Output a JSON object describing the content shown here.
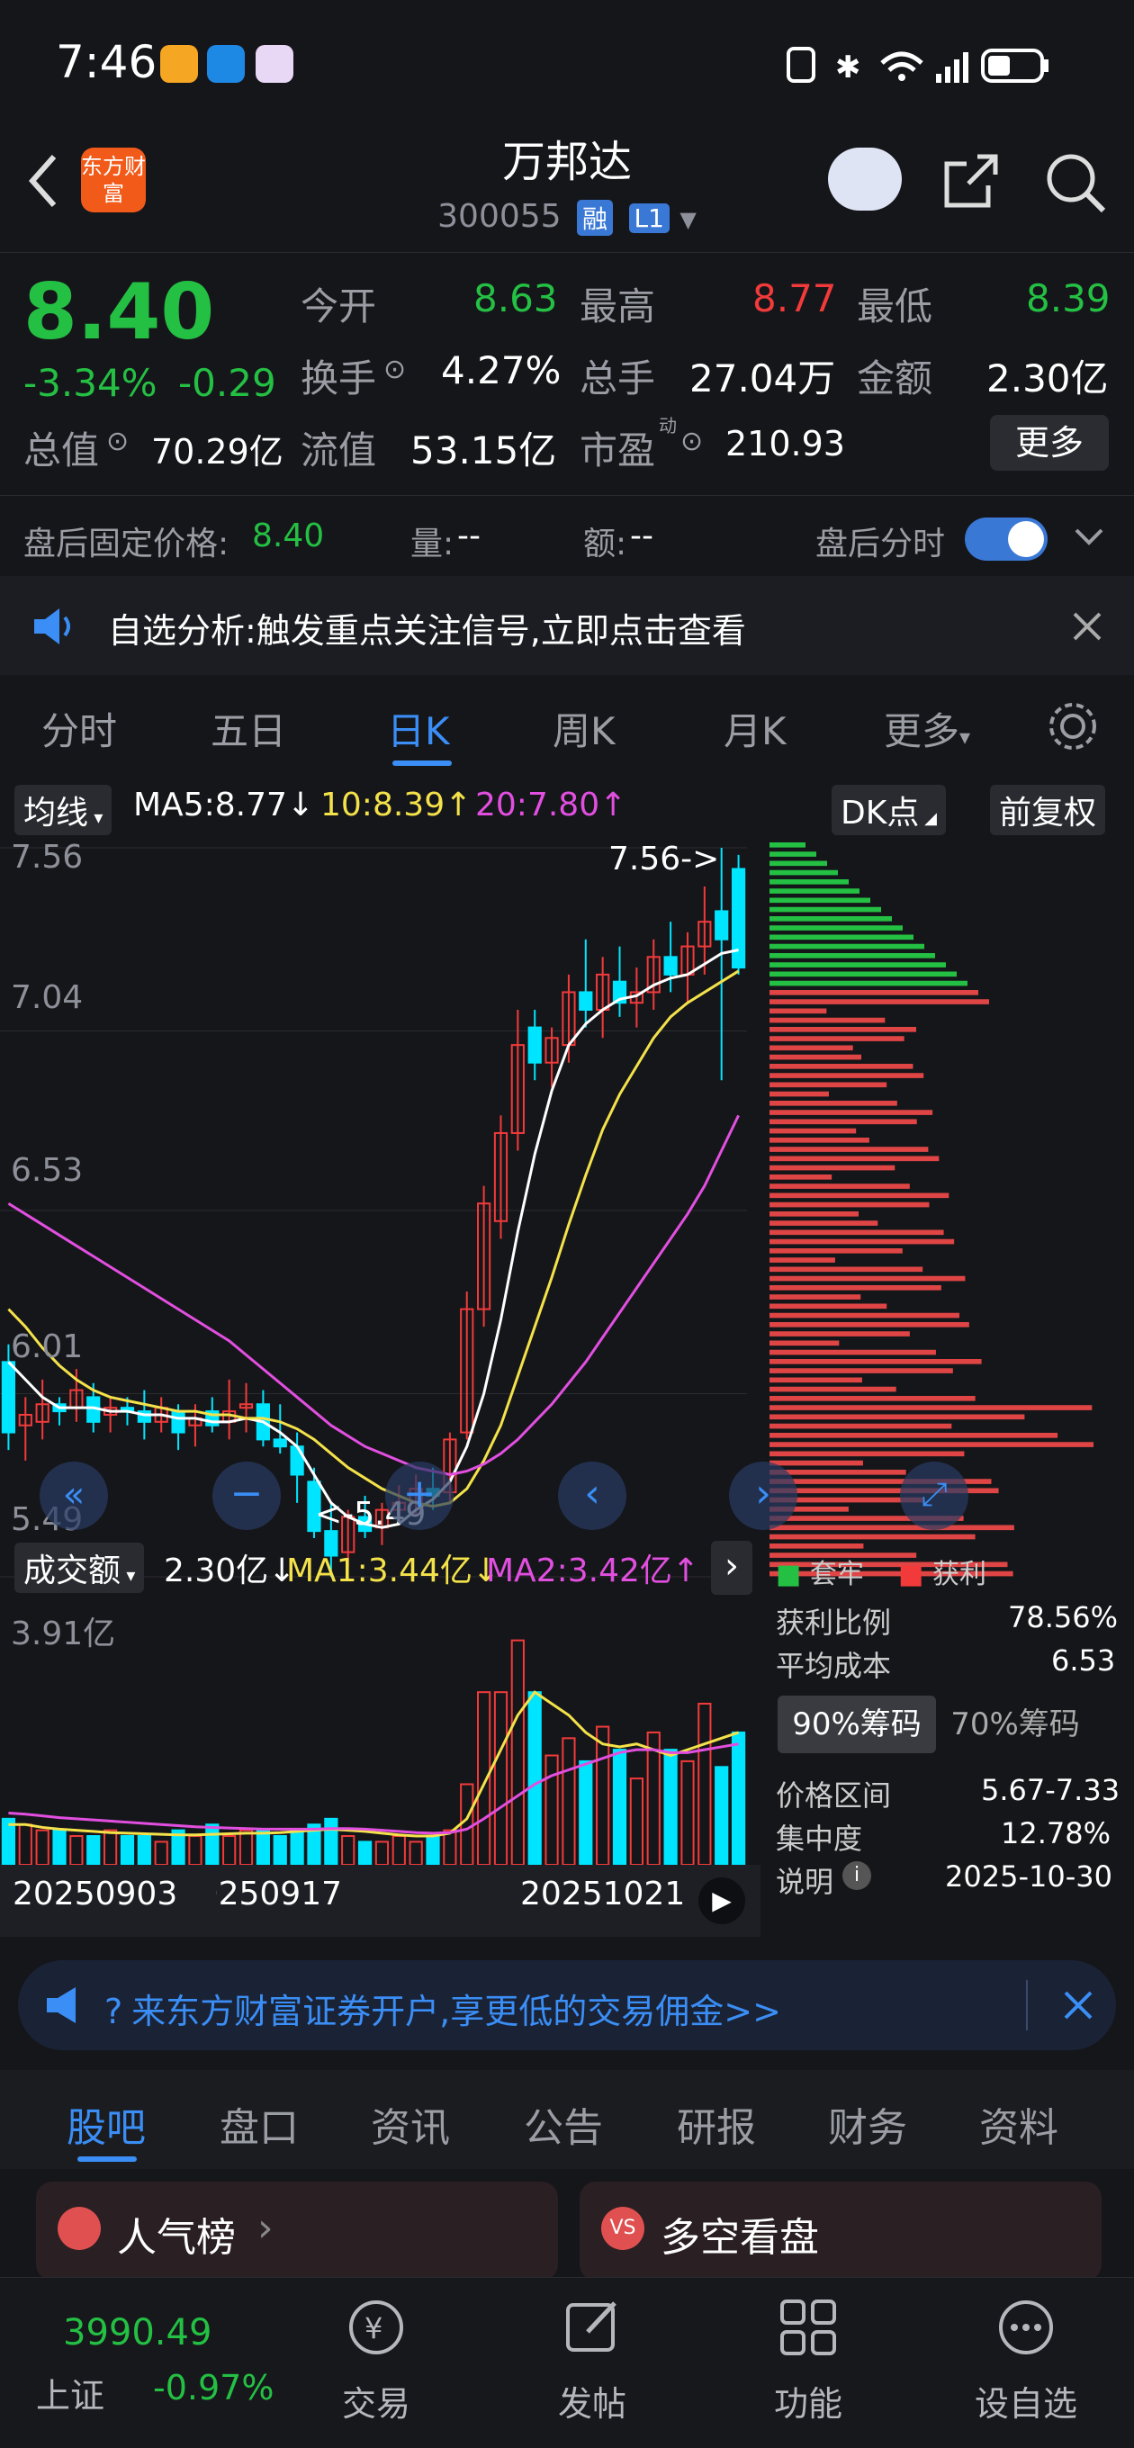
{
  "status": {
    "time": "7:46"
  },
  "header": {
    "logo": "东方财富",
    "name": "万邦达",
    "code": "300055",
    "tag1": "融",
    "tag2": "L1"
  },
  "quote": {
    "price": "8.40",
    "change_pct": "-3.34%",
    "change": "-0.29",
    "open_label": "今开",
    "open": "8.63",
    "high_label": "最高",
    "high": "8.77",
    "low_label": "最低",
    "low": "8.39",
    "turnover_label": "换手",
    "turnover": "4.27%",
    "volume_label": "总手",
    "volume": "27.04万",
    "amount_label": "金额",
    "amount": "2.30亿",
    "mktcap_label": "总值",
    "mktcap": "70.29亿",
    "float_label": "流值",
    "float": "53.15亿",
    "pe_label": "市盈",
    "pe_sup": "动",
    "pe": "210.93",
    "more": "更多"
  },
  "after_hours": {
    "label": "盘后固定价格:",
    "price": "8.40",
    "vol_label": "量:",
    "vol": "--",
    "amt_label": "额:",
    "amt": "--",
    "switch_label": "盘后分时",
    "switch_on": true
  },
  "notice": {
    "text": "自选分析:触发重点关注信号,立即点击查看"
  },
  "tabs": [
    "分时",
    "五日",
    "日K",
    "周K",
    "月K",
    "更多"
  ],
  "chart": {
    "ma_selector": "均线",
    "ma5": "MA5:8.77↓",
    "ma10": "10:8.39↑",
    "ma20": "20:7.80↑",
    "dk_button": "DK点",
    "adjust_button": "前复权",
    "y_labels": [
      "7.56",
      "7.04",
      "6.53",
      "6.01",
      "5.49"
    ],
    "high_marker": "7.56->",
    "low_marker": "<-5.49",
    "vol_selector": "成交额",
    "vol_value": "2.30亿↓",
    "vol_ma1": "MA1:3.44亿↓",
    "vol_ma2": "MA2:3.42亿↑",
    "vol_max": "3.91亿",
    "x_labels": [
      "20250903",
      "20250917",
      "20251021"
    ],
    "colors": {
      "up": "#f23a3a",
      "down": "#00e5ff",
      "ma5": "#ffffff",
      "ma10": "#f4e24a",
      "ma20": "#e24fe0"
    }
  },
  "chips": {
    "legend_trapped": "套牢",
    "legend_profit": "获利",
    "profit_ratio_label": "获利比例",
    "profit_ratio": "78.56%",
    "avg_cost_label": "平均成本",
    "avg_cost": "6.53",
    "tab90": "90%筹码",
    "tab70": "70%筹码",
    "range_label": "价格区间",
    "range": "5.67-7.33",
    "concentration_label": "集中度",
    "concentration": "12.78%",
    "note_label": "说明",
    "date": "2025-10-30"
  },
  "promo": {
    "text": "来东方财富证券开户,享更低的交易佣金>>"
  },
  "section_tabs": [
    "股吧",
    "盘口",
    "资讯",
    "公告",
    "研报",
    "财务",
    "资料"
  ],
  "cards": {
    "left": "人气榜",
    "right": "多空看盘"
  },
  "bottom_nav": {
    "index_value": "3990.49",
    "index_name": "上证",
    "index_change": "-0.97%",
    "items": [
      "交易",
      "发帖",
      "功能",
      "设自选"
    ]
  },
  "chart_data": {
    "type": "candlestick",
    "ylim": [
      5.49,
      7.56
    ],
    "candles": [
      {
        "o": 6.1,
        "h": 6.15,
        "l": 5.85,
        "c": 5.9
      },
      {
        "o": 5.92,
        "h": 6.0,
        "l": 5.82,
        "c": 5.95
      },
      {
        "o": 5.93,
        "h": 6.05,
        "l": 5.88,
        "c": 5.98
      },
      {
        "o": 5.98,
        "h": 6.0,
        "l": 5.92,
        "c": 5.96
      },
      {
        "o": 5.97,
        "h": 6.08,
        "l": 5.93,
        "c": 6.02
      },
      {
        "o": 6.0,
        "h": 6.04,
        "l": 5.9,
        "c": 5.93
      },
      {
        "o": 5.95,
        "h": 6.0,
        "l": 5.9,
        "c": 5.97
      },
      {
        "o": 5.97,
        "h": 6.0,
        "l": 5.92,
        "c": 5.96
      },
      {
        "o": 5.96,
        "h": 6.02,
        "l": 5.88,
        "c": 5.93
      },
      {
        "o": 5.93,
        "h": 6.0,
        "l": 5.9,
        "c": 5.97
      },
      {
        "o": 5.96,
        "h": 5.98,
        "l": 5.85,
        "c": 5.9
      },
      {
        "o": 5.92,
        "h": 5.98,
        "l": 5.86,
        "c": 5.94
      },
      {
        "o": 5.96,
        "h": 6.0,
        "l": 5.9,
        "c": 5.92
      },
      {
        "o": 5.93,
        "h": 6.05,
        "l": 5.88,
        "c": 5.96
      },
      {
        "o": 5.97,
        "h": 6.04,
        "l": 5.9,
        "c": 5.98
      },
      {
        "o": 5.98,
        "h": 6.02,
        "l": 5.86,
        "c": 5.88
      },
      {
        "o": 5.88,
        "h": 5.98,
        "l": 5.84,
        "c": 5.86
      },
      {
        "o": 5.86,
        "h": 5.9,
        "l": 5.7,
        "c": 5.78
      },
      {
        "o": 5.76,
        "h": 5.8,
        "l": 5.6,
        "c": 5.62
      },
      {
        "o": 5.62,
        "h": 5.7,
        "l": 5.49,
        "c": 5.55
      },
      {
        "o": 5.56,
        "h": 5.68,
        "l": 5.52,
        "c": 5.66
      },
      {
        "o": 5.66,
        "h": 5.72,
        "l": 5.6,
        "c": 5.62
      },
      {
        "o": 5.63,
        "h": 5.7,
        "l": 5.58,
        "c": 5.68
      },
      {
        "o": 5.68,
        "h": 5.75,
        "l": 5.64,
        "c": 5.7
      },
      {
        "o": 5.7,
        "h": 5.78,
        "l": 5.66,
        "c": 5.74
      },
      {
        "o": 5.74,
        "h": 5.8,
        "l": 5.68,
        "c": 5.72
      },
      {
        "o": 5.73,
        "h": 5.9,
        "l": 5.7,
        "c": 5.88
      },
      {
        "o": 5.9,
        "h": 6.3,
        "l": 5.88,
        "c": 6.25
      },
      {
        "o": 6.25,
        "h": 6.6,
        "l": 6.2,
        "c": 6.55
      },
      {
        "o": 6.5,
        "h": 6.8,
        "l": 6.45,
        "c": 6.75
      },
      {
        "o": 6.75,
        "h": 7.1,
        "l": 6.7,
        "c": 7.0
      },
      {
        "o": 7.05,
        "h": 7.1,
        "l": 6.9,
        "c": 6.95
      },
      {
        "o": 6.95,
        "h": 7.05,
        "l": 6.88,
        "c": 7.02
      },
      {
        "o": 7.0,
        "h": 7.2,
        "l": 6.95,
        "c": 7.15
      },
      {
        "o": 7.15,
        "h": 7.3,
        "l": 7.05,
        "c": 7.1
      },
      {
        "o": 7.1,
        "h": 7.25,
        "l": 7.02,
        "c": 7.2
      },
      {
        "o": 7.18,
        "h": 7.28,
        "l": 7.08,
        "c": 7.12
      },
      {
        "o": 7.12,
        "h": 7.22,
        "l": 7.05,
        "c": 7.15
      },
      {
        "o": 7.15,
        "h": 7.3,
        "l": 7.1,
        "c": 7.25
      },
      {
        "o": 7.25,
        "h": 7.35,
        "l": 7.15,
        "c": 7.2
      },
      {
        "o": 7.2,
        "h": 7.32,
        "l": 7.12,
        "c": 7.28
      },
      {
        "o": 7.28,
        "h": 7.45,
        "l": 7.2,
        "c": 7.35
      },
      {
        "o": 7.38,
        "h": 7.56,
        "l": 6.9,
        "c": 7.3
      },
      {
        "o": 7.5,
        "h": 7.54,
        "l": 7.2,
        "c": 7.22
      }
    ],
    "ma5": [
      6.1,
      6.05,
      6.0,
      5.97,
      5.97,
      5.97,
      5.96,
      5.96,
      5.95,
      5.95,
      5.94,
      5.94,
      5.93,
      5.93,
      5.94,
      5.93,
      5.9,
      5.86,
      5.78,
      5.7,
      5.66,
      5.64,
      5.63,
      5.64,
      5.68,
      5.71,
      5.76,
      5.86,
      6.01,
      6.22,
      6.47,
      6.69,
      6.87,
      7.0,
      7.06,
      7.1,
      7.13,
      7.14,
      7.17,
      7.19,
      7.2,
      7.23,
      7.26,
      7.27
    ],
    "ma10": [
      6.25,
      6.2,
      6.14,
      6.09,
      6.05,
      6.02,
      6.0,
      5.99,
      5.98,
      5.97,
      5.96,
      5.96,
      5.95,
      5.95,
      5.94,
      5.94,
      5.93,
      5.91,
      5.88,
      5.84,
      5.8,
      5.77,
      5.74,
      5.72,
      5.7,
      5.69,
      5.7,
      5.74,
      5.82,
      5.92,
      6.06,
      6.2,
      6.34,
      6.49,
      6.63,
      6.76,
      6.86,
      6.94,
      7.02,
      7.08,
      7.12,
      7.15,
      7.18,
      7.21
    ],
    "ma20": [
      6.55,
      6.52,
      6.49,
      6.46,
      6.43,
      6.4,
      6.37,
      6.34,
      6.31,
      6.28,
      6.25,
      6.22,
      6.19,
      6.16,
      6.12,
      6.08,
      6.04,
      6.0,
      5.96,
      5.92,
      5.89,
      5.86,
      5.84,
      5.82,
      5.8,
      5.79,
      5.78,
      5.79,
      5.81,
      5.84,
      5.88,
      5.93,
      5.98,
      6.04,
      6.1,
      6.17,
      6.24,
      6.31,
      6.38,
      6.45,
      6.52,
      6.6,
      6.7,
      6.8
    ],
    "volume": [
      0.8,
      0.7,
      0.6,
      0.6,
      0.5,
      0.5,
      0.6,
      0.5,
      0.5,
      0.4,
      0.6,
      0.5,
      0.7,
      0.5,
      0.6,
      0.6,
      0.5,
      0.6,
      0.7,
      0.8,
      0.5,
      0.4,
      0.4,
      0.5,
      0.4,
      0.5,
      0.6,
      1.4,
      3.0,
      3.0,
      3.9,
      3.0,
      1.9,
      2.2,
      1.8,
      2.4,
      2.0,
      1.5,
      2.3,
      2.0,
      1.8,
      2.8,
      1.7,
      2.3
    ],
    "vol_ma1": [
      0.7,
      0.7,
      0.65,
      0.62,
      0.6,
      0.58,
      0.56,
      0.55,
      0.54,
      0.53,
      0.52,
      0.52,
      0.53,
      0.54,
      0.55,
      0.55,
      0.56,
      0.58,
      0.6,
      0.62,
      0.6,
      0.58,
      0.55,
      0.52,
      0.5,
      0.5,
      0.55,
      0.8,
      1.4,
      2.0,
      2.6,
      3.0,
      2.8,
      2.6,
      2.3,
      2.1,
      2.05,
      2.1,
      2.0,
      1.9,
      2.0,
      2.1,
      2.2,
      2.3
    ],
    "vol_ma2": [
      0.9,
      0.88,
      0.85,
      0.82,
      0.8,
      0.78,
      0.76,
      0.74,
      0.72,
      0.7,
      0.68,
      0.66,
      0.65,
      0.64,
      0.63,
      0.62,
      0.62,
      0.62,
      0.62,
      0.63,
      0.63,
      0.62,
      0.6,
      0.58,
      0.56,
      0.55,
      0.56,
      0.62,
      0.8,
      1.0,
      1.2,
      1.4,
      1.55,
      1.65,
      1.75,
      1.85,
      1.95,
      2.0,
      2.0,
      1.95,
      1.95,
      2.0,
      2.05,
      2.1
    ]
  }
}
